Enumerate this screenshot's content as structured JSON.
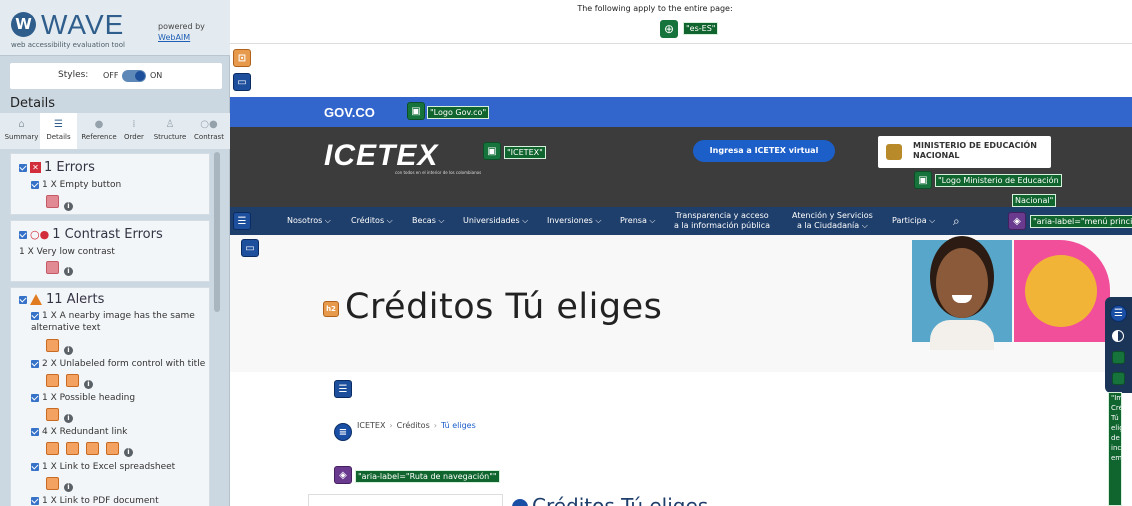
{
  "wave": {
    "logo_letter": "W",
    "name": "WAVE",
    "subtitle": "web accessibility evaluation tool",
    "powered_by": "powered by",
    "webaim": "WebAIM"
  },
  "styles": {
    "label": "Styles:",
    "off": "OFF",
    "on": "ON"
  },
  "details_title": "Details",
  "tabs": [
    {
      "label": "Summary",
      "icon": "home-icon",
      "glyph": "⌂"
    },
    {
      "label": "Details",
      "icon": "list-icon",
      "glyph": "☰"
    },
    {
      "label": "Reference",
      "icon": "info-icon",
      "glyph": "●"
    },
    {
      "label": "Order",
      "icon": "order-icon",
      "glyph": "⁞"
    },
    {
      "label": "Structure",
      "icon": "structure-icon",
      "glyph": "♙"
    },
    {
      "label": "Contrast",
      "icon": "contrast-icon",
      "glyph": "○●"
    }
  ],
  "errors": {
    "title": "1 Errors",
    "badge": "✕",
    "items": [
      {
        "label": "1 X Empty button"
      }
    ]
  },
  "contrast": {
    "title": "1 Contrast Errors",
    "badge": "○●",
    "items": [
      {
        "label": "1 X Very low contrast"
      }
    ]
  },
  "alerts": {
    "title": "11 Alerts",
    "items": [
      {
        "label": "1 X A nearby image has the same alternative text"
      },
      {
        "label": "2 X Unlabeled form control with title"
      },
      {
        "label": "1 X Possible heading"
      },
      {
        "label": "4 X Redundant link"
      },
      {
        "label": "1 X Link to Excel spreadsheet"
      },
      {
        "label": "1 X Link to PDF document"
      }
    ]
  },
  "page": {
    "top_note": "The following apply to the entire page:",
    "lang_tag": "\"es-ES\"",
    "gov_text": "GOV.CO",
    "gov_tag": "\"Logo Gov.co\"",
    "icetex_logo": "ICETEX",
    "icetex_sub": "con todos en el interior de los colombianos",
    "icetex_tag": "\"ICETEX\"",
    "ingresa": "Ingresa a ICETEX virtual",
    "ministerio": [
      "MINISTERIO DE EDUCACIÓN",
      "NACIONAL"
    ],
    "ministerio_tag_1": "\"Logo Ministerio de Educación",
    "ministerio_tag_2": "Nacional\"",
    "nav": [
      {
        "label": "Nosotros ⌵"
      },
      {
        "label": "Créditos ⌵"
      },
      {
        "label": "Becas ⌵"
      },
      {
        "label": "Universidades ⌵"
      },
      {
        "label": "Inversiones ⌵"
      },
      {
        "label": "Prensa ⌵"
      },
      {
        "label": "Transparencia y acceso\na la información pública"
      },
      {
        "label": "Atención y Servicios\na la Ciudadanía ⌵"
      },
      {
        "label": "Participa ⌵"
      }
    ],
    "nav_search": "⌕",
    "nav_tag": "\"aria-label=\"menú principal",
    "hero_title": "Créditos Tú eliges",
    "h_badge": "h2",
    "breadcrumb": [
      "ICETEX",
      "Créditos",
      "Tú eliges"
    ],
    "breadcrumb_sep": "›",
    "breadcrumb_tag": "\"aria-label=\"Ruta de navegación\"\"",
    "sub_heading": "Créditos Tú eliges",
    "right_tag": "\"Imágenes Créditos Tú eliges de inc em"
  },
  "icons": {
    "globe": "globe-icon",
    "structure": "structure-icon",
    "alt": "alt-text-icon",
    "aria": "aria-icon",
    "error": "error-icon",
    "alert": "alert-icon"
  }
}
